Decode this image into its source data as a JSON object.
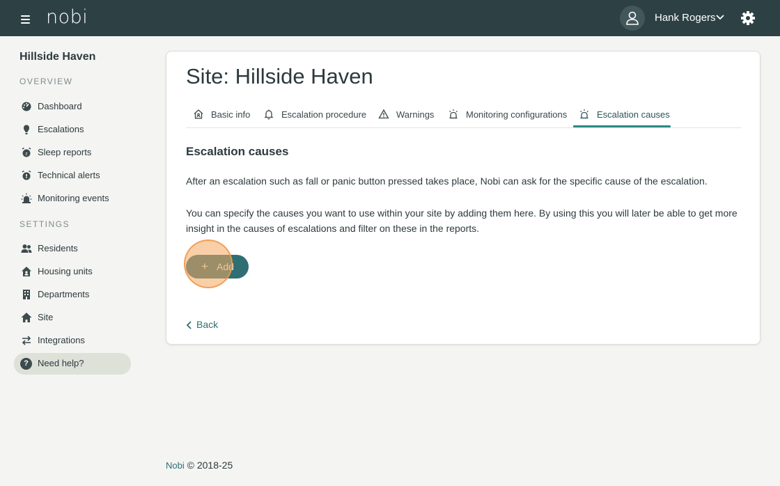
{
  "header": {
    "logo": "nobi",
    "user_name": "Hank Rogers",
    "colors": {
      "topbar": "#2d4145",
      "accent": "#2a8a86"
    }
  },
  "sidebar": {
    "site_name": "Hillside Haven",
    "overview_label": "OVERVIEW",
    "settings_label": "SETTINGS",
    "overview_items": [
      {
        "label": "Dashboard",
        "icon": "dashboard-icon"
      },
      {
        "label": "Escalations",
        "icon": "escalation-icon"
      },
      {
        "label": "Sleep reports",
        "icon": "sleep-report-icon"
      },
      {
        "label": "Technical alerts",
        "icon": "technical-alert-icon"
      },
      {
        "label": "Monitoring events",
        "icon": "siren-icon"
      }
    ],
    "settings_items": [
      {
        "label": "Residents",
        "icon": "residents-icon"
      },
      {
        "label": "Housing units",
        "icon": "housing-unit-icon"
      },
      {
        "label": "Departments",
        "icon": "building-icon"
      },
      {
        "label": "Site",
        "icon": "home-icon"
      },
      {
        "label": "Integrations",
        "icon": "swap-arrows-icon"
      }
    ],
    "help_label": "Need help?"
  },
  "main": {
    "title": "Site: Hillside Haven",
    "tabs": [
      {
        "label": "Basic info",
        "icon": "house-outline-icon"
      },
      {
        "label": "Escalation procedure",
        "icon": "bell-icon"
      },
      {
        "label": "Warnings",
        "icon": "warning-triangle-icon"
      },
      {
        "label": "Monitoring configurations",
        "icon": "siren-icon"
      },
      {
        "label": "Escalation causes",
        "icon": "siren-icon",
        "active": true
      }
    ],
    "section_title": "Escalation causes",
    "paragraph_1": "After an escalation such as fall or panic button pressed takes place, Nobi can ask for the specific cause of the escalation.",
    "paragraph_2": "You can specify the causes you want to use within your site by adding them here. By using this you will later be able to get more insight in the causes of escalations and filter on these in the reports.",
    "add_button": "Add",
    "back_link": "Back"
  },
  "footer": {
    "brand": "Nobi",
    "copyright": "© 2018-25"
  }
}
